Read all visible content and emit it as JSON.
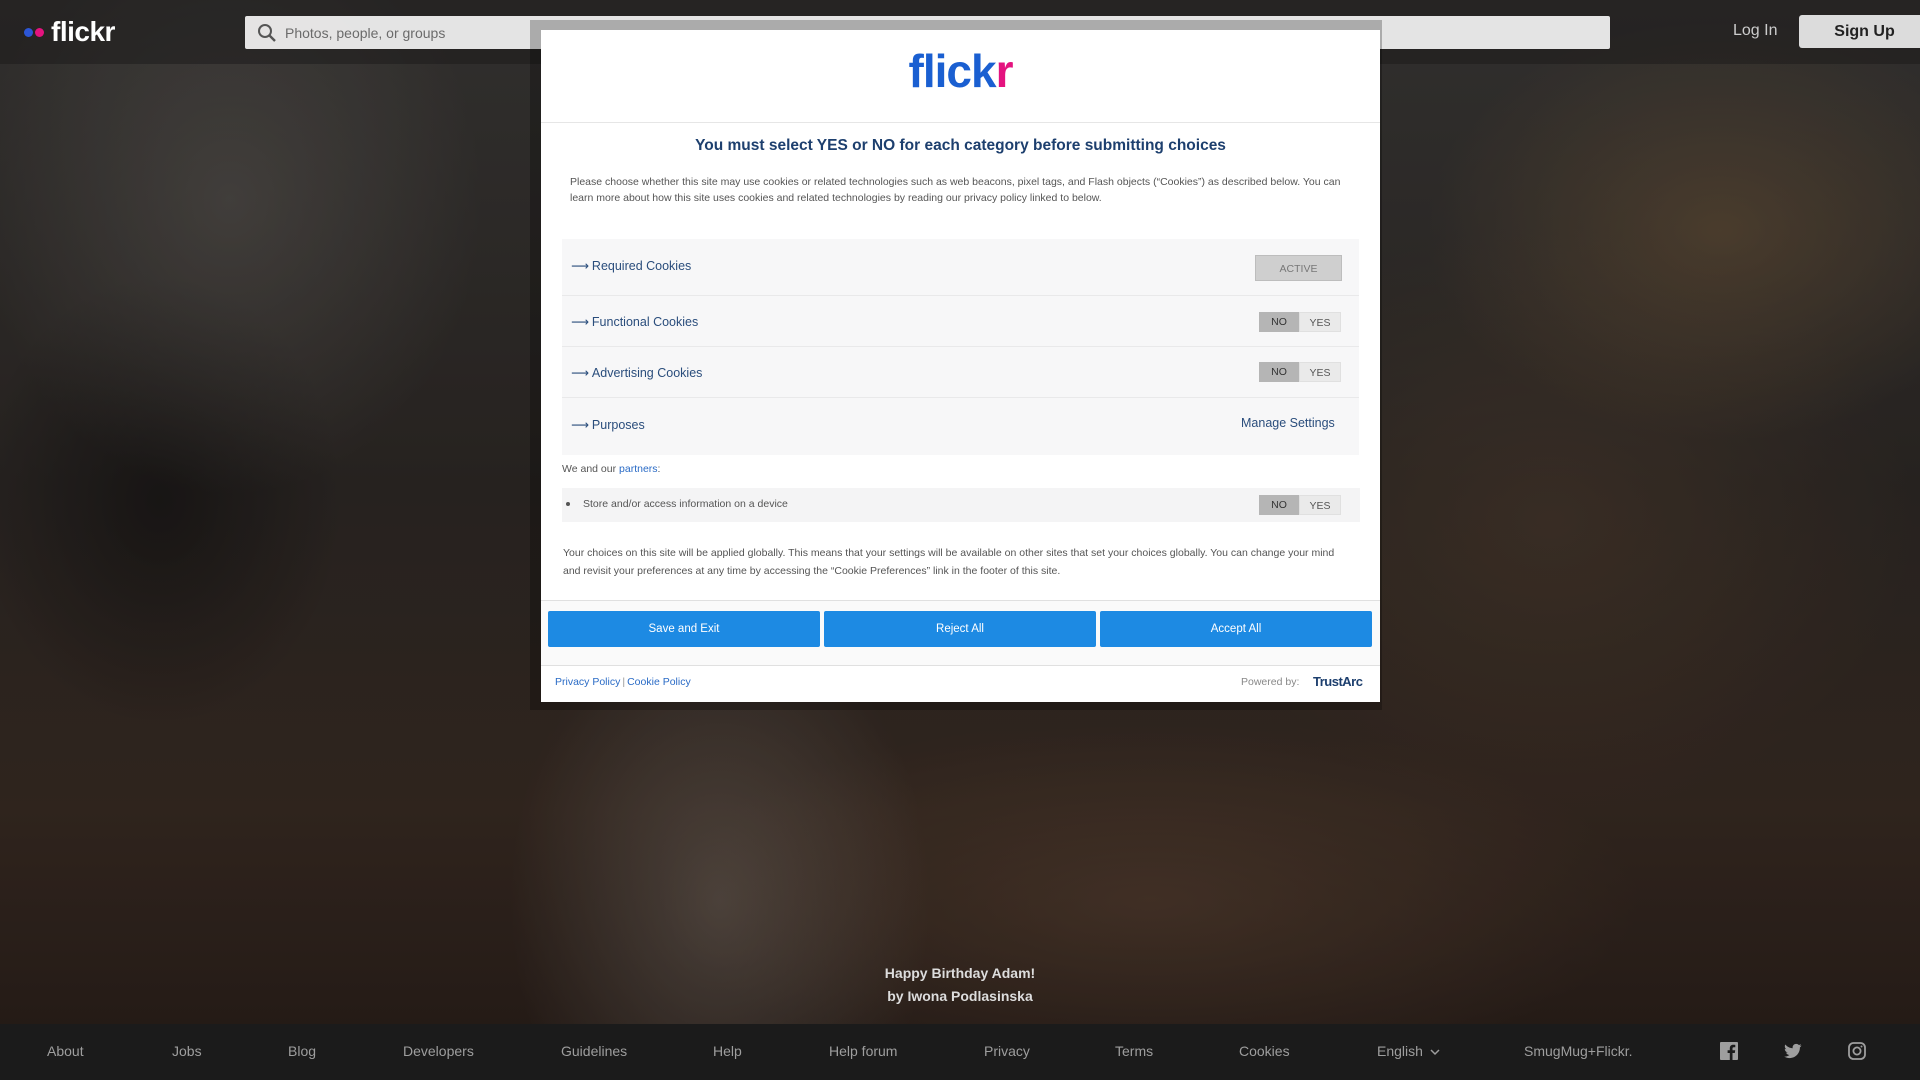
{
  "topnav": {
    "logo_text": "flickr",
    "search_placeholder": "Photos, people, or groups",
    "login_label": "Log In",
    "signup_label": "Sign Up"
  },
  "photo_credit": {
    "title": "Happy Birthday Adam!",
    "author": "by Iwona Podlasinska"
  },
  "footer": {
    "links": [
      "About",
      "Jobs",
      "Blog",
      "Developers",
      "Guidelines",
      "Help",
      "Help forum",
      "Privacy",
      "Terms",
      "Cookies",
      "English",
      "SmugMug+Flickr."
    ],
    "social_icons": [
      "facebook-icon",
      "twitter-icon",
      "instagram-icon"
    ]
  },
  "modal": {
    "logo": {
      "part1": "flick",
      "part2": "r"
    },
    "title": "You must select YES or NO for each category before submitting choices",
    "intro": "Please choose whether this site may use cookies or related technologies such as web beacons, pixel tags, and Flash objects (“Cookies”) as described below. You can learn more about how this site uses cookies and related technologies by reading our privacy policy linked to below.",
    "categories": [
      {
        "label": "Required Cookies",
        "status": "ACTIVE"
      },
      {
        "label": "Functional Cookies",
        "no": "NO",
        "yes": "YES"
      },
      {
        "label": "Advertising Cookies",
        "no": "NO",
        "yes": "YES"
      },
      {
        "label": "Purposes",
        "action": "Manage Settings"
      }
    ],
    "arrow": "⟶",
    "partners_prefix": "We and our ",
    "partners_link": "partners",
    "partners_suffix": ":",
    "store_row": {
      "label": "Store and/or access information on a device",
      "no": "NO",
      "yes": "YES"
    },
    "global_note": "Your choices on this site will be applied globally. This means that your settings will be available on other sites that set your choices globally. You can change your mind and revisit your preferences at any time by accessing the “Cookie Preferences” link in the footer of this site.",
    "buttons": {
      "save": "Save and Exit",
      "reject": "Reject All",
      "accept": "Accept All"
    },
    "footer": {
      "privacy_policy": "Privacy Policy",
      "separator": "|",
      "cookie_policy": "Cookie Policy",
      "powered_by": "Powered by:",
      "provider": "TrustArc"
    }
  },
  "colors": {
    "flickr_blue": "#1a5fd1",
    "flickr_pink": "#e4137f",
    "button_blue": "#1d8ae3",
    "title_navy": "#1d3f6e"
  }
}
